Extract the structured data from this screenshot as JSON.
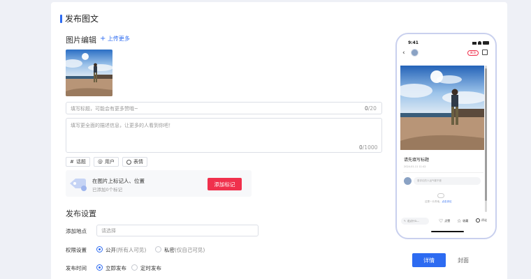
{
  "page": {
    "title": "发布图文"
  },
  "images": {
    "section_title": "图片编辑",
    "upload_more": "上传更多"
  },
  "title_input": {
    "placeholder": "填写标题，可能会有更多赞哦~",
    "count": "0",
    "max": "/20"
  },
  "desc_input": {
    "placeholder": "填写更全面的描述信息，让更多的人看到你吧！",
    "count": "0",
    "max": "/1000"
  },
  "chips": [
    {
      "icon": "#",
      "label": "话题"
    },
    {
      "icon": "@",
      "label": "用户"
    },
    {
      "icon": "smile-icon",
      "label": "表情"
    }
  ],
  "mark": {
    "title": "在图片上标记人、位置",
    "subtitle": "已添加0个标记",
    "button": "添加标记"
  },
  "settings": {
    "section_title": "发布设置",
    "location": {
      "label": "添加地点",
      "placeholder": "请选择"
    },
    "permission": {
      "label": "权限设置",
      "options": [
        {
          "text": "公开",
          "note": "(所有人可见)",
          "selected": true
        },
        {
          "text": "私密",
          "note": "(仅自己可见)",
          "selected": false
        }
      ]
    },
    "time": {
      "label": "发布时间",
      "options": [
        {
          "text": "立即发布",
          "selected": true
        },
        {
          "text": "定时发布",
          "selected": false
        }
      ]
    }
  },
  "preview": {
    "status_time": "9:41",
    "follow": "关注",
    "post_title": "请先填写标题",
    "date": "2024-01-11 11:42",
    "comment_placeholder": "爱评论的人运气都不差",
    "empty_text": "这是一片荒地，",
    "empty_link": "点击评论",
    "bottom_input": "说点什么...",
    "actions": [
      "点赞",
      "收藏",
      "评论"
    ]
  },
  "tabs": [
    {
      "label": "详情",
      "active": true
    },
    {
      "label": "封面",
      "active": false
    }
  ],
  "colors": {
    "accent": "#2d6bf1",
    "danger": "#f0304c",
    "background": "#eef0f6"
  }
}
